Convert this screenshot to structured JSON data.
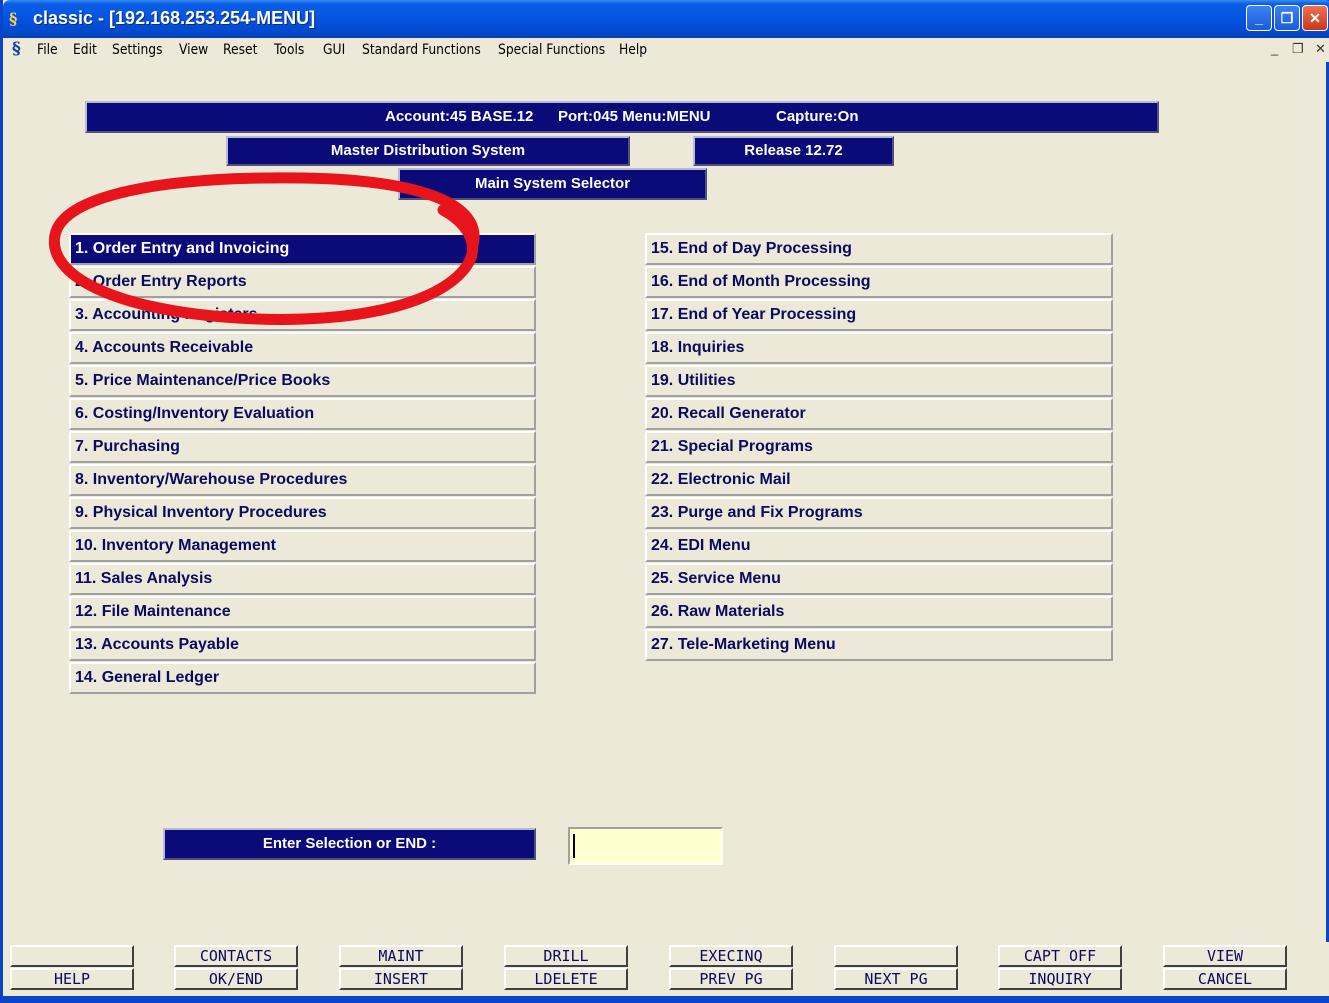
{
  "window": {
    "title": "classic - [192.168.253.254-MENU]",
    "app_icon": "sh-app-icon",
    "minimize": "_",
    "maximize": "❐",
    "close": "✕"
  },
  "menubar": {
    "items": [
      "File",
      "Edit",
      "Settings",
      "View",
      "Reset",
      "Tools",
      "GUI",
      "Standard Functions",
      "Special Functions",
      "Help"
    ],
    "mdi_minimize": "_",
    "mdi_restore": "❐",
    "mdi_close": "✕"
  },
  "header": {
    "account": "Account:45 BASE.12",
    "port_menu": "Port:045 Menu:MENU",
    "capture": "Capture:On",
    "system": "Master Distribution System",
    "release": "Release 12.72",
    "selector": "Main System Selector"
  },
  "left_menu": [
    "1. Order Entry and Invoicing",
    "2. Order Entry Reports",
    "3. Accounting Registers",
    "4. Accounts Receivable",
    "5. Price Maintenance/Price Books",
    "6. Costing/Inventory Evaluation",
    "7. Purchasing",
    "8. Inventory/Warehouse Procedures",
    "9. Physical Inventory Procedures",
    "10. Inventory Management",
    "11. Sales Analysis",
    "12. File Maintenance",
    "13. Accounts Payable",
    "14. General Ledger"
  ],
  "right_menu": [
    "15. End of Day Processing",
    "16. End of Month Processing",
    "17. End of Year Processing",
    "18. Inquiries",
    "19. Utilities",
    "20. Recall Generator",
    "21. Special Programs",
    "22. Electronic Mail",
    "23. Purge and Fix Programs",
    "24. EDI Menu",
    "25. Service Menu",
    "26. Raw Materials",
    "27. Tele-Marketing Menu"
  ],
  "selected_item": 1,
  "annotation": {
    "color": "#e8141c",
    "shape": "ellipse-highlight"
  },
  "prompt": {
    "label": "Enter Selection or END :",
    "value": ""
  },
  "function_keys": {
    "top": [
      "",
      "CONTACTS",
      "MAINT",
      "DRILL",
      "EXECINQ",
      "",
      "CAPT OFF",
      "VIEW"
    ],
    "bottom": [
      "HELP",
      "OK/END",
      "INSERT",
      "LDELETE",
      "PREV PG",
      "NEXT PG",
      "INQUIRY",
      "CANCEL"
    ]
  },
  "colors": {
    "navy": "#0a0a78",
    "background": "#ece9d8",
    "input_bg": "#ffffd0"
  }
}
